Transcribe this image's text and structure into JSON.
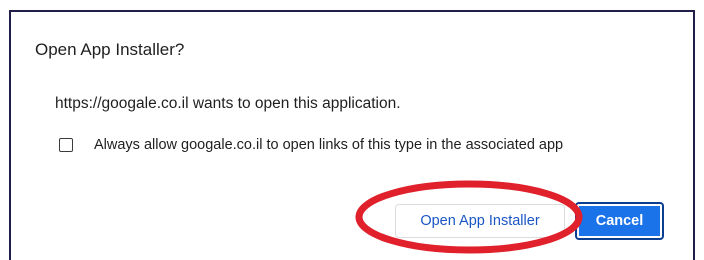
{
  "dialog": {
    "title": "Open App Installer?",
    "message": "https://googale.co.il wants to open this application.",
    "checkbox_label": "Always allow googale.co.il to open links of this type in the associated app",
    "checkbox_checked": false,
    "open_button_label": "Open App Installer",
    "cancel_button_label": "Cancel"
  },
  "colors": {
    "primary_button": "#1a73e8",
    "secondary_button_text": "#1a56c4",
    "annotation": "#e0202a",
    "frame_border": "#1f1f48"
  }
}
